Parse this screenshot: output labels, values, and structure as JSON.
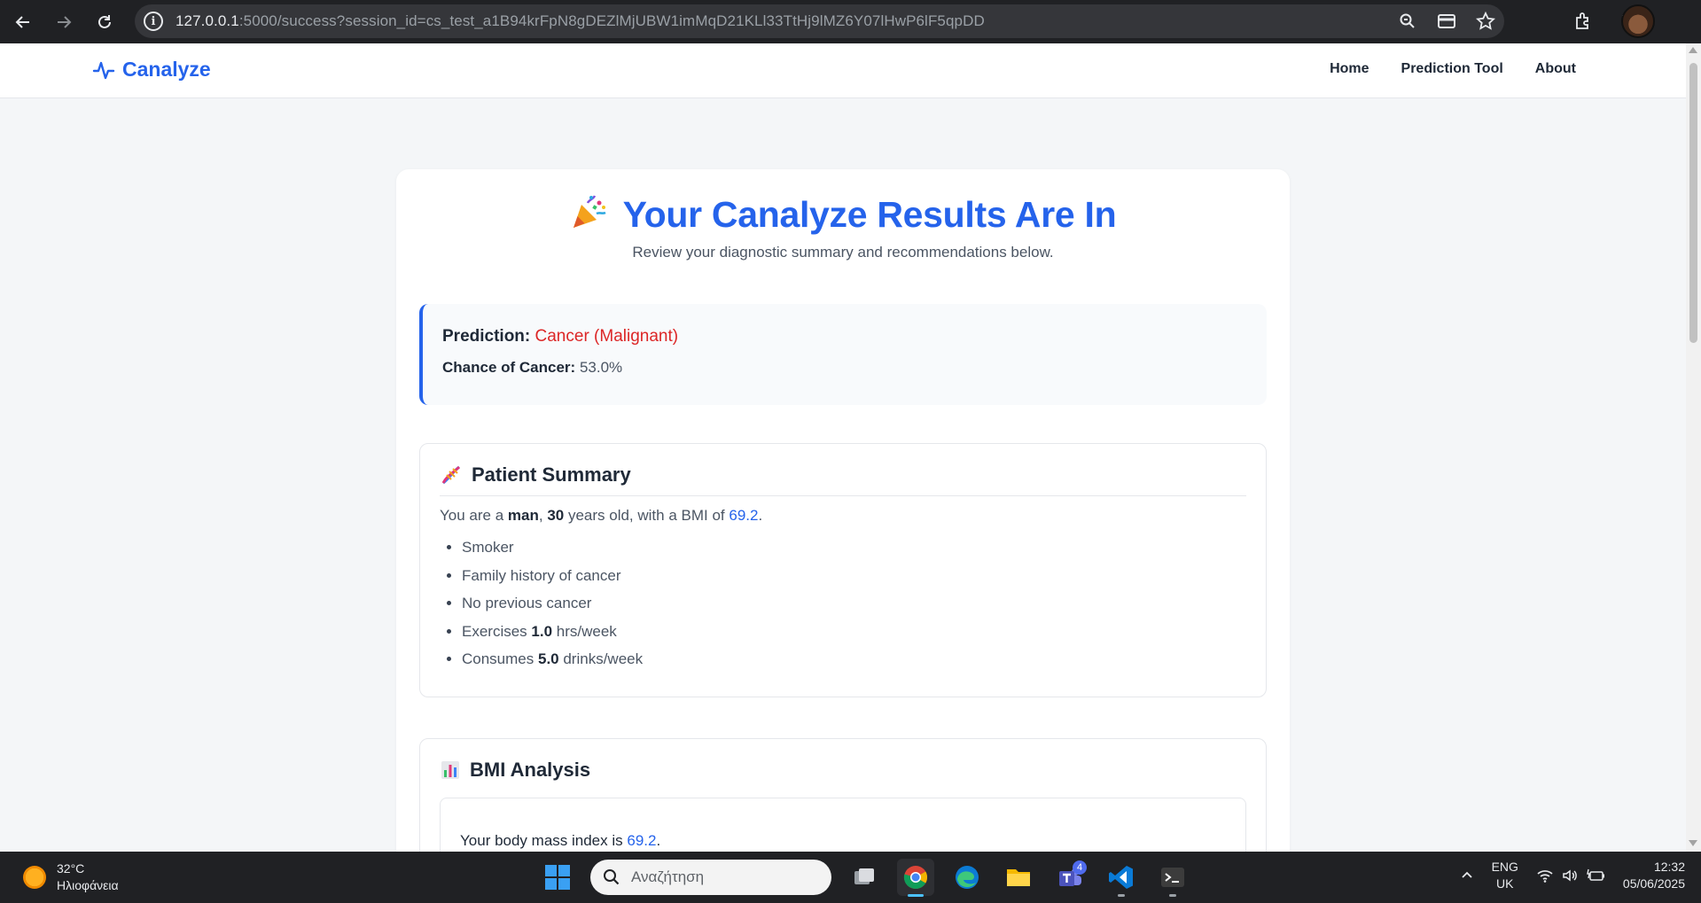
{
  "browser": {
    "url_host": "127.0.0.1",
    "url_rest": ":5000/success?session_id=cs_test_a1B94krFpN8gDEZlMjUBW1imMqD21KLl33TtHj9lMZ6Y07lHwP6lF5qpDD"
  },
  "navbar": {
    "brand": "Canalyze",
    "links": [
      "Home",
      "Prediction Tool",
      "About"
    ]
  },
  "header": {
    "title": "Your Canalyze Results Are In",
    "subtitle": "Review your diagnostic summary and recommendations below."
  },
  "prediction": {
    "label": "Prediction:",
    "value": "Cancer (Malignant)",
    "chance_label": "Chance of Cancer:",
    "chance_value": "53.0%",
    "value_color": "#dc2626"
  },
  "summary": {
    "heading": "Patient Summary",
    "intro_pre": "You are a ",
    "sex": "man",
    "intro_mid1": ", ",
    "age": "30",
    "intro_mid2": " years old, with a BMI of ",
    "bmi": "69.2",
    "intro_end": ".",
    "items": {
      "smoker": "Smoker",
      "family": "Family history of cancer",
      "previous": "No previous cancer",
      "exercise_pre": "Exercises ",
      "exercise_val": "1.0",
      "exercise_post": " hrs/week",
      "drinks_pre": "Consumes ",
      "drinks_val": "5.0",
      "drinks_post": " drinks/week"
    }
  },
  "bmi_section": {
    "heading": "BMI Analysis",
    "text_pre": "Your body mass index is ",
    "value": "69.2",
    "text_end": "."
  },
  "taskbar": {
    "temperature": "32°C",
    "weather": "Ηλιοφάνεια",
    "search_placeholder": "Αναζήτηση",
    "teams_badge": "4",
    "lang_top": "ENG",
    "lang_bottom": "UK",
    "time": "12:32",
    "date": "05/06/2025"
  },
  "colors": {
    "accent": "#2563eb",
    "danger": "#dc2626",
    "chrome_bg": "#202124"
  }
}
